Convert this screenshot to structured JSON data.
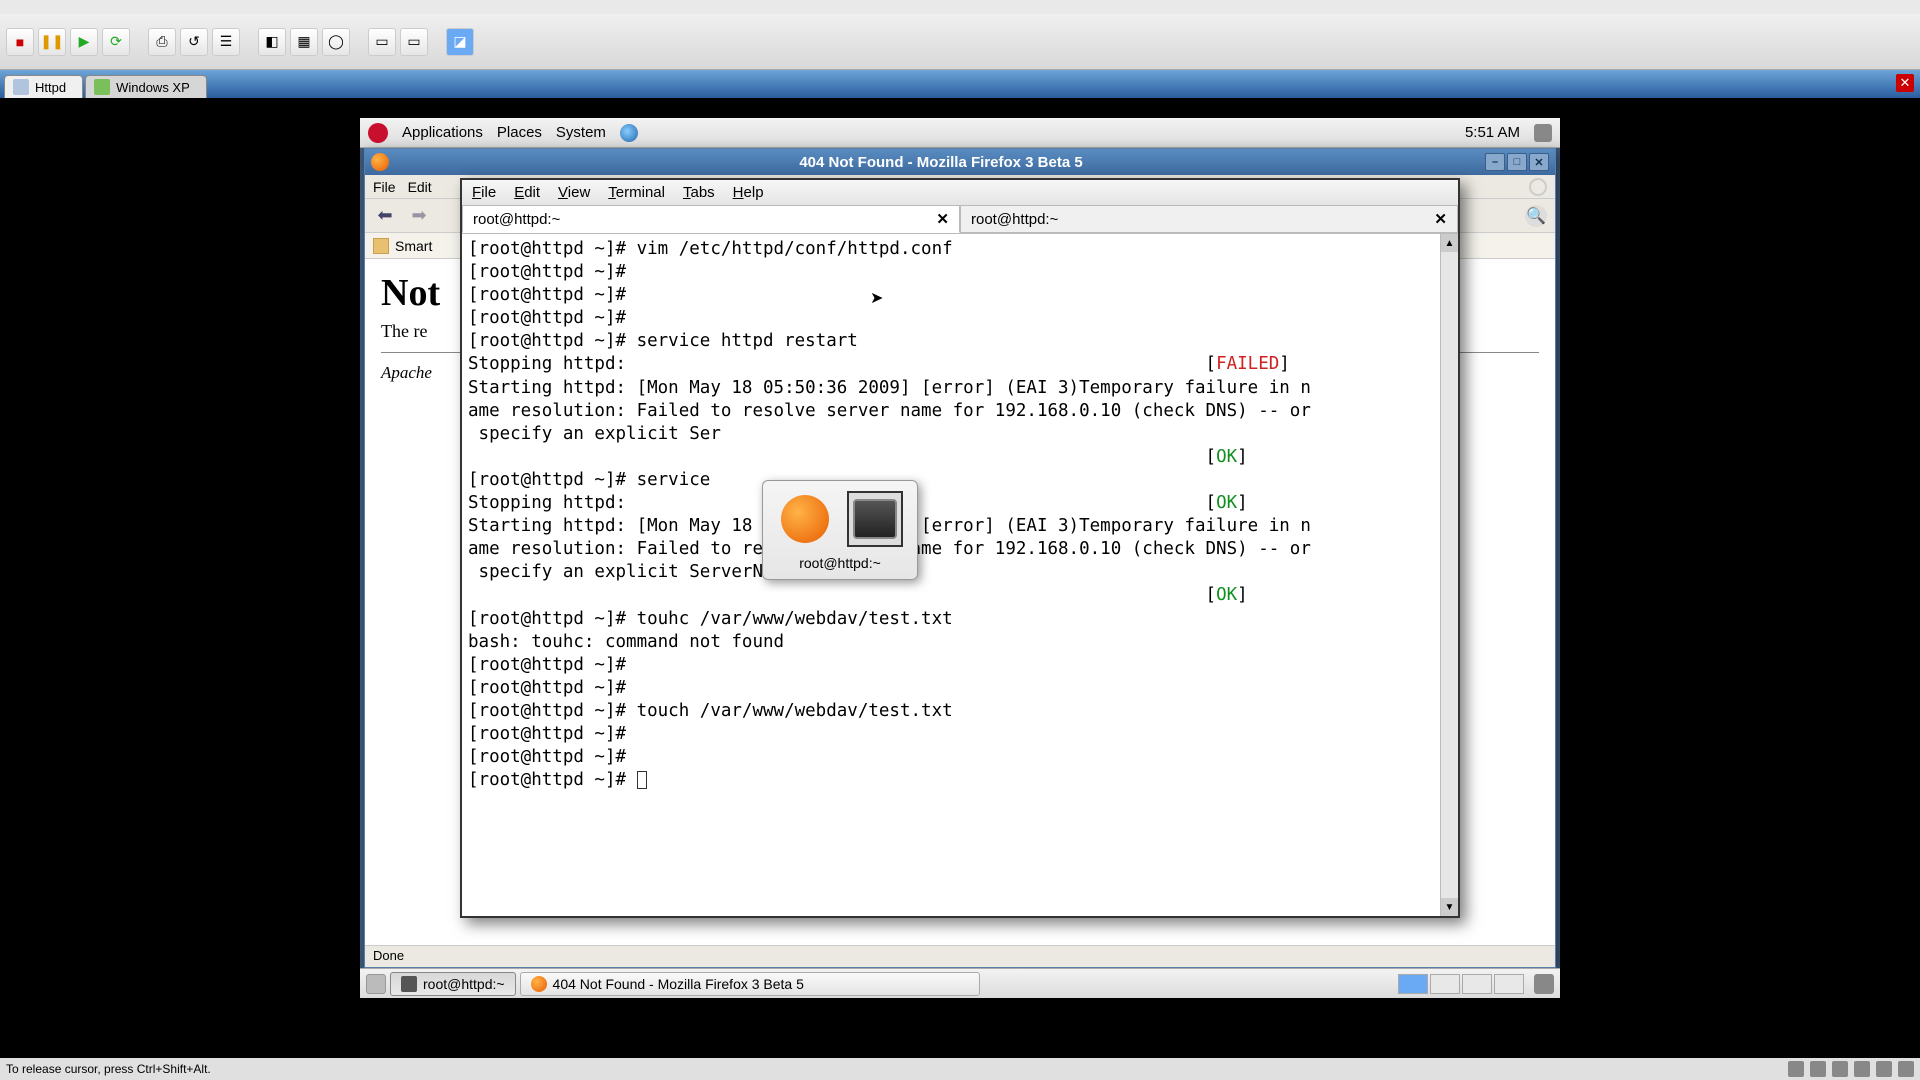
{
  "vm_host": {
    "tabs": [
      {
        "label": "Httpd",
        "active": true
      },
      {
        "label": "Windows XP",
        "active": false
      }
    ],
    "status_hint": "To release cursor, press Ctrl+Shift+Alt."
  },
  "gnome_top": {
    "items": [
      "Applications",
      "Places",
      "System"
    ],
    "time": "5:51 AM"
  },
  "firefox": {
    "app_title": "404 Not Found - Mozilla Firefox 3 Beta 5",
    "menu": [
      "File",
      "Edit"
    ],
    "bookmark_label": "Smart",
    "page_h1": "Not",
    "page_p": "The re",
    "page_server": "Apache",
    "status": "Done"
  },
  "terminal": {
    "menu": [
      "File",
      "Edit",
      "View",
      "Terminal",
      "Tabs",
      "Help"
    ],
    "tabs": [
      {
        "title": "root@httpd:~",
        "active": true
      },
      {
        "title": "root@httpd:~",
        "active": false
      }
    ],
    "lines": [
      {
        "t": "[root@httpd ~]# vim /etc/httpd/conf/httpd.conf"
      },
      {
        "t": "[root@httpd ~]#"
      },
      {
        "t": "[root@httpd ~]#"
      },
      {
        "t": "[root@httpd ~]#"
      },
      {
        "t": "[root@httpd ~]# service httpd restart"
      },
      {
        "t": "Stopping httpd:",
        "status": "FAILED",
        "status_color": "red"
      },
      {
        "t": "Starting httpd: [Mon May 18 05:50:36 2009] [error] (EAI 3)Temporary failure in n"
      },
      {
        "t": "ame resolution: Failed to resolve server name for 192.168.0.10 (check DNS) -- or"
      },
      {
        "t": " specify an explicit Ser"
      },
      {
        "t": "",
        "status": "OK",
        "status_color": "green"
      },
      {
        "t": "[root@httpd ~]# service"
      },
      {
        "t": "Stopping httpd:",
        "status": "OK",
        "status_color": "green"
      },
      {
        "t": "Starting httpd: [Mon May 18 05:50:39 2009] [error] (EAI 3)Temporary failure in n"
      },
      {
        "t": "ame resolution: Failed to resolve server name for 192.168.0.10 (check DNS) -- or"
      },
      {
        "t": " specify an explicit ServerName"
      },
      {
        "t": "",
        "status": "OK",
        "status_color": "green"
      },
      {
        "t": "[root@httpd ~]# touhc /var/www/webdav/test.txt"
      },
      {
        "t": "bash: touhc: command not found"
      },
      {
        "t": "[root@httpd ~]#"
      },
      {
        "t": "[root@httpd ~]#"
      },
      {
        "t": "[root@httpd ~]# touch /var/www/webdav/test.txt"
      },
      {
        "t": "[root@httpd ~]#"
      },
      {
        "t": "[root@httpd ~]#"
      },
      {
        "t": "[root@httpd ~]# ",
        "cursor": true
      }
    ]
  },
  "switcher": {
    "label": "root@httpd:~"
  },
  "taskbar": {
    "items": [
      {
        "label": "root@httpd:~",
        "pressed": true,
        "icon": "terminal"
      },
      {
        "label": "404 Not Found - Mozilla Firefox 3 Beta 5",
        "pressed": false,
        "icon": "firefox"
      }
    ]
  }
}
